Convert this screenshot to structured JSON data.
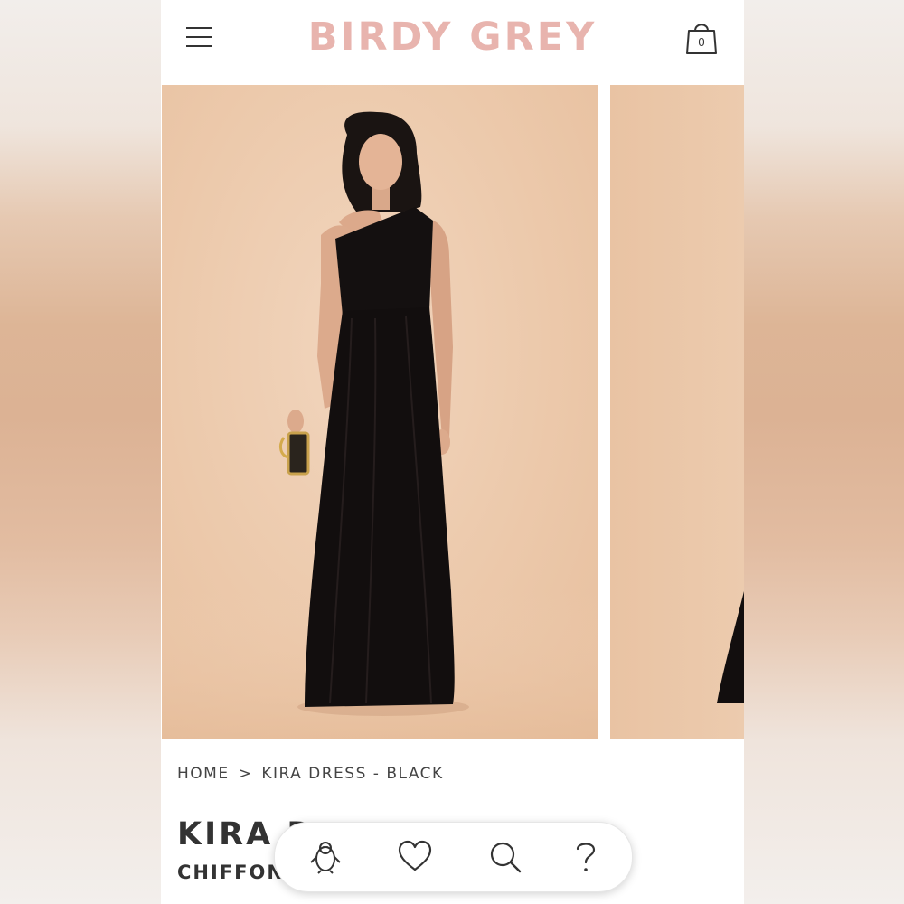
{
  "brand": {
    "logo_text": "BIRDY GREY",
    "logo_color": "#e8b4ae"
  },
  "header": {
    "menu_icon": "hamburger-menu-icon",
    "cart_icon": "shopping-bag-icon",
    "cart_count": "0"
  },
  "gallery": {
    "images": [
      {
        "subject": "model-in-black-one-shoulder-gown",
        "background": "#ecc9ab"
      },
      {
        "subject": "partial-next-image",
        "background": "#eac6a8"
      }
    ]
  },
  "breadcrumb": {
    "items": [
      "HOME",
      "KIRA DRESS - BLACK"
    ],
    "separator": ">"
  },
  "product": {
    "title": "KIRA D",
    "subtitle": "CHIFFON"
  },
  "float_bar": {
    "buttons": [
      {
        "icon": "penguin-icon"
      },
      {
        "icon": "heart-icon"
      },
      {
        "icon": "search-icon"
      },
      {
        "icon": "help-question-icon"
      }
    ]
  }
}
